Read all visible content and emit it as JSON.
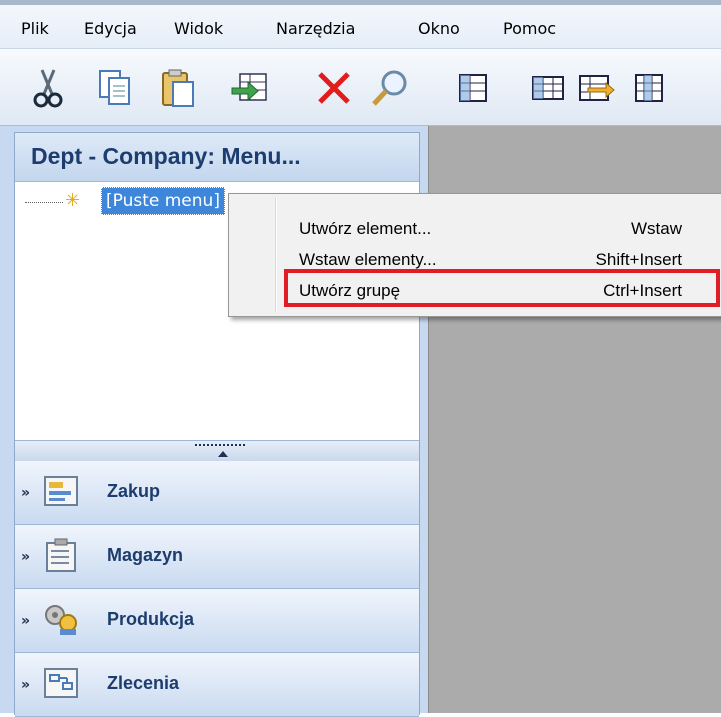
{
  "menubar": {
    "items": [
      "Plik",
      "Edycja",
      "Widok",
      "Narzędzia",
      "Okno",
      "Pomoc"
    ]
  },
  "toolbar": {
    "icons": [
      "cut-icon",
      "copy-icon",
      "paste-icon",
      "import-icon",
      "delete-icon",
      "search-icon",
      "table-icon",
      "table-pair-icon",
      "table-export-icon",
      "grid-icon"
    ]
  },
  "panel": {
    "title": "Dept - Company: Menu...",
    "tree_node": "[Puste menu]",
    "nav": [
      {
        "label": "Zakup",
        "icon": "purchase-icon"
      },
      {
        "label": "Magazyn",
        "icon": "warehouse-icon"
      },
      {
        "label": "Produkcja",
        "icon": "production-icon"
      },
      {
        "label": "Zlecenia",
        "icon": "orders-icon"
      }
    ]
  },
  "context_menu": {
    "items": [
      {
        "label": "Utwórz element...",
        "shortcut": "Wstaw"
      },
      {
        "label": "Wstaw elementy...",
        "shortcut": "Shift+Insert"
      },
      {
        "label": "Utwórz grupę",
        "shortcut": "Ctrl+Insert"
      }
    ],
    "highlight_color": "#e01c24"
  }
}
